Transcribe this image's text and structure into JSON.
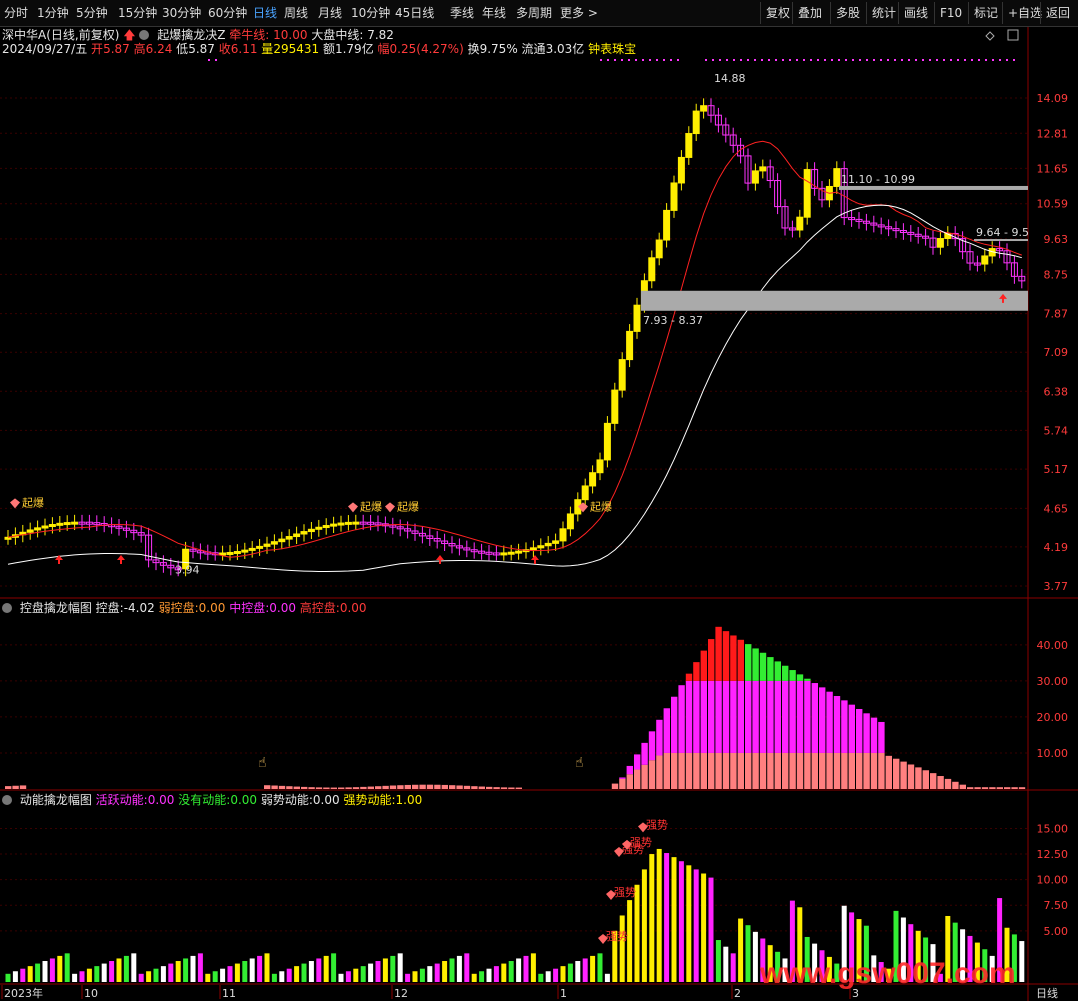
{
  "toolbar": {
    "periods": [
      "分时",
      "1分钟",
      "5分钟",
      "15分钟",
      "30分钟",
      "60分钟",
      "日线",
      "周线",
      "月线",
      "10分钟",
      "45日线",
      "季线",
      "年线",
      "多周期",
      "更多 >"
    ],
    "active_period": "日线",
    "right_buttons": [
      "复权",
      "叠加",
      "多股",
      "统计",
      "画线",
      "F10",
      "标记",
      "+自选",
      "返回"
    ]
  },
  "header": {
    "stock": "深中华A(日线,前复权)",
    "formula": "起爆擒龙决Z",
    "bull_line_label": "牵牛线:",
    "bull_line_value": "10.00",
    "market_mid_label": "大盘中线:",
    "market_mid_value": "7.82",
    "date": "2024/09/27/五",
    "open_label": "开",
    "open": "5.87",
    "high_label": "高",
    "high": "6.24",
    "low_label": "低",
    "low": "5.87",
    "close_label": "收",
    "close": "6.11",
    "volume_label": "量",
    "volume": "295431",
    "amount_label": "额",
    "amount": "1.79亿",
    "change_label": "幅",
    "change": "0.25(4.27%)",
    "turnover_label": "换",
    "turnover": "9.75%",
    "float_label": "流通",
    "float_cap": "3.03亿",
    "extra": "钟表珠宝"
  },
  "price_axis": [
    "14.09",
    "12.81",
    "11.65",
    "10.59",
    "9.63",
    "8.75",
    "7.87",
    "7.09",
    "6.38",
    "5.74",
    "5.17",
    "4.65",
    "4.19",
    "3.77"
  ],
  "annotations": {
    "peak": "14.88",
    "low": "3.94",
    "zone_upper": "11.10 - 10.99",
    "zone_mid": "9.64 - 9.5",
    "zone_lower": "7.93 - 8.37",
    "signal": "起爆"
  },
  "pane2": {
    "title": "控盘擒龙幅图",
    "control_label": "控盘:",
    "control_value": "-4.02",
    "weak_label": "弱控盘:",
    "weak_value": "0.00",
    "mid_label": "中控盘:",
    "mid_value": "0.00",
    "high_label": "高控盘:",
    "high_value": "0.00",
    "axis": [
      "40.00",
      "30.00",
      "20.00",
      "10.00"
    ]
  },
  "pane3": {
    "title": "动能擒龙幅图",
    "active_label": "活跃动能:",
    "active_value": "0.00",
    "none_label": "没有动能:",
    "none_value": "0.00",
    "weak_label": "弱势动能:",
    "weak_value": "0.00",
    "strong_label": "强势动能:",
    "strong_value": "1.00",
    "axis": [
      "15.00",
      "12.50",
      "10.00",
      "7.50",
      "5.00"
    ],
    "tag": "强势"
  },
  "time_axis": {
    "labels": [
      "2023年",
      "10",
      "11",
      "12",
      "1",
      "2",
      "3"
    ],
    "period_button": "日线"
  },
  "watermark": "www.gsw007.com",
  "colors": {
    "up": "#ffee00",
    "down": "#ff33ff",
    "neutral": "#33ee33",
    "axis": "#ff3b3b",
    "grid": "#3a0000",
    "zone": "#aaaaaa"
  }
}
